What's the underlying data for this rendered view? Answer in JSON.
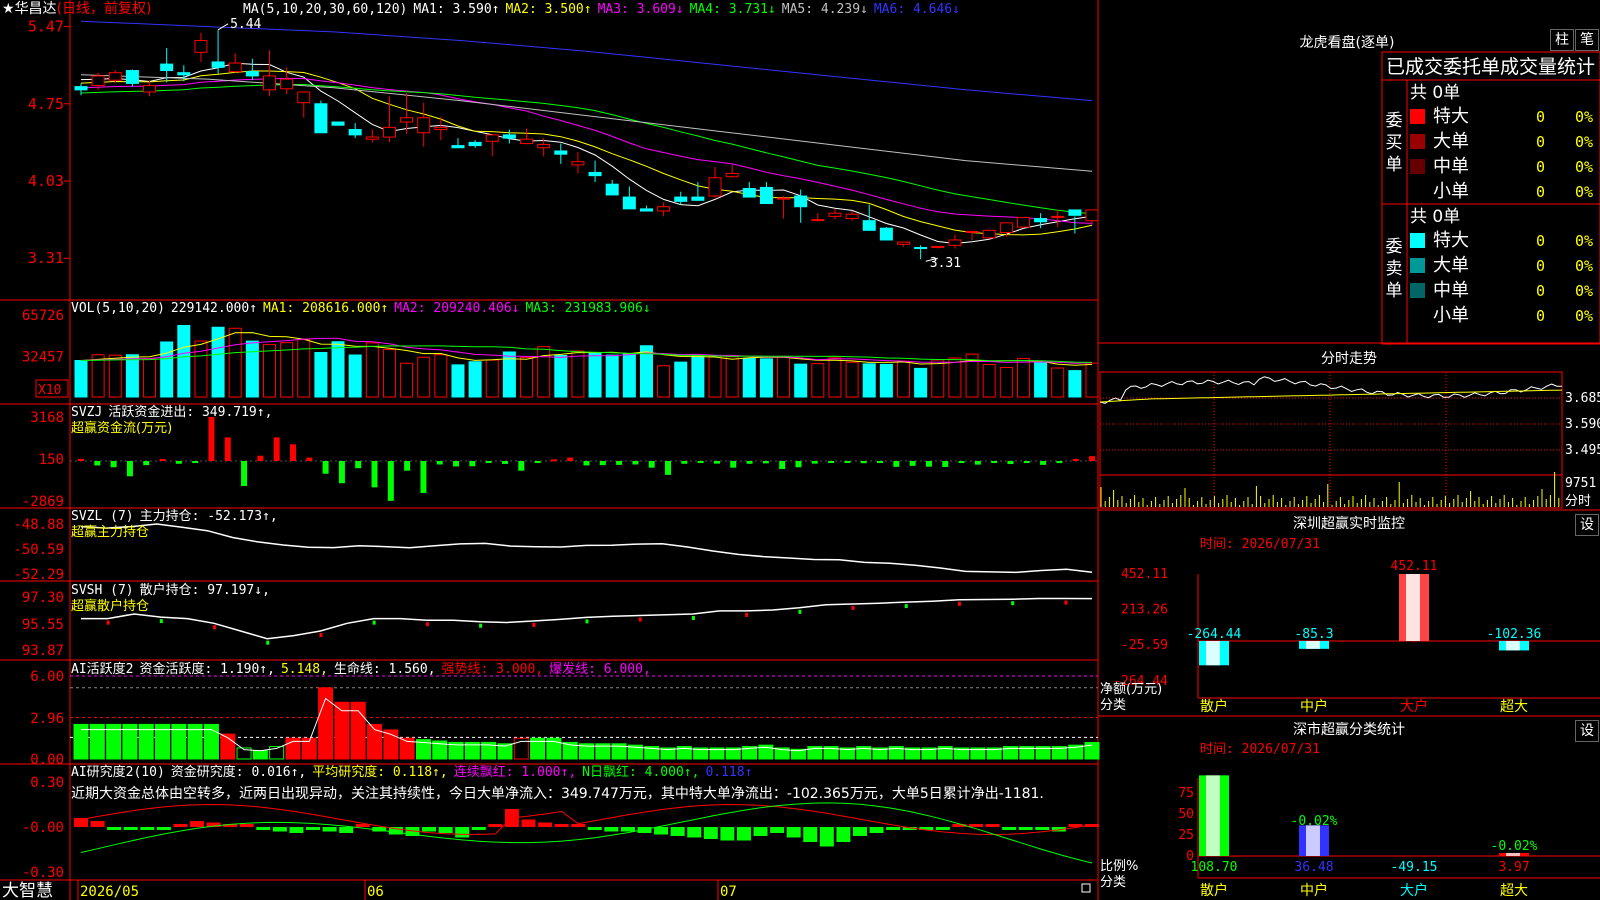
{
  "stock": {
    "star": "★",
    "name": "华昌达",
    "mode": "(日线，前复权)"
  },
  "kline": {
    "ma_header": [
      {
        "text": "MA(5,10,20,30,60,120)",
        "color": "#ffffff"
      },
      {
        "text": "MA1: 3.590↑",
        "color": "#ffffff"
      },
      {
        "text": "MA2: 3.500↑",
        "color": "#ffff00"
      },
      {
        "text": "MA3: 3.609↓",
        "color": "#ff00ff"
      },
      {
        "text": "MA4: 3.731↓",
        "color": "#00ff00"
      },
      {
        "text": "MA5: 4.239↓",
        "color": "#c0c0c0"
      },
      {
        "text": "MA6: 4.646↓",
        "color": "#3333ff"
      }
    ],
    "high_marker": "5.44",
    "low_marker": "3.31",
    "y_labels": [
      "5.47",
      "4.75",
      "4.03",
      "3.31"
    ]
  },
  "volume": {
    "header": [
      {
        "text": "VOL(5,10,20)",
        "color": "#ffffff"
      },
      {
        "text": "229142.000↑",
        "color": "#ffffff"
      },
      {
        "text": "MA1: 208616.000↑",
        "color": "#ffff00"
      },
      {
        "text": "MA2: 209240.406↓",
        "color": "#ff00ff"
      },
      {
        "text": "MA3: 231983.906↓",
        "color": "#00ff00"
      }
    ],
    "y_labels": [
      "65726",
      "32457"
    ],
    "unit": "X10"
  },
  "svzj": {
    "header": [
      {
        "text": "SVZJ",
        "color": "#ffffff"
      },
      {
        "text": "活跃资金进出: 349.719↑,",
        "color": "#ffffff"
      }
    ],
    "subtitle": "超赢资金流(万元)",
    "y_labels": [
      "3168",
      "150",
      "-2869"
    ]
  },
  "svzl": {
    "header": [
      {
        "text": "SVZL (7)",
        "color": "#ffffff"
      },
      {
        "text": "主力持仓: -52.173↑,",
        "color": "#ffffff"
      }
    ],
    "subtitle": "超赢主力持仓",
    "y_labels": [
      "-48.88",
      "-50.59",
      "-52.29"
    ]
  },
  "svsh": {
    "header": [
      {
        "text": "SVSH (7)",
        "color": "#ffffff"
      },
      {
        "text": "散户持仓: 97.197↓,",
        "color": "#ffffff"
      }
    ],
    "subtitle": "超赢散户持仓",
    "y_labels": [
      "97.30",
      "95.55",
      "93.87"
    ]
  },
  "ai_active": {
    "header": [
      {
        "text": "AI活跃度2",
        "color": "#ffffff"
      },
      {
        "text": "资金活跃度: 1.190↑,",
        "color": "#ffffff"
      },
      {
        "text": "5.148,",
        "color": "#ffff00"
      },
      {
        "text": "生命线: 1.560,",
        "color": "#ffffff"
      },
      {
        "text": "强势线: 3.000,",
        "color": "#ff0000"
      },
      {
        "text": "爆发线: 6.000,",
        "color": "#ff00ff"
      }
    ],
    "y_labels": [
      "6.00",
      "2.96",
      "0.00"
    ]
  },
  "ai_research": {
    "header": [
      {
        "text": "AI研究度2(10)",
        "color": "#ffffff"
      },
      {
        "text": "资金研究度: 0.016↑,",
        "color": "#ffffff"
      },
      {
        "text": "平均研究度: 0.118↑,",
        "color": "#ffff00"
      },
      {
        "text": "连续飘红: 1.000↑,",
        "color": "#ff00ff"
      },
      {
        "text": "N日飘红: 4.000↑,",
        "color": "#00ff00"
      },
      {
        "text": "0.118↑",
        "color": "#3333ff"
      }
    ],
    "commentary": "近期大资金总体由空转多，近两日出现异动，关注其持续性，今日大单净流入：349.747万元，其中特大单净流出：-102.365万元，大单5日累计净出-1181.",
    "y_labels": [
      "0.30",
      "-0.00",
      "-0.30"
    ]
  },
  "xaxis": {
    "brand": "大智慧",
    "labels": [
      "2026/05",
      "06",
      "07"
    ]
  },
  "lhb": {
    "title": "龙虎看盘(逐单)",
    "tab_zhu": "柱",
    "tab_bi": "笔",
    "stats_title": "已成交委托单成交量统计",
    "buy_label": "委买单",
    "sell_label": "委卖单",
    "buy": {
      "count": "共 0单",
      "rows": [
        {
          "label": "特大",
          "value": "0",
          "pct": "0%",
          "color": "#ff0000"
        },
        {
          "label": "大单",
          "value": "0",
          "pct": "0%",
          "color": "#990000"
        },
        {
          "label": "中单",
          "value": "0",
          "pct": "0%",
          "color": "#660000"
        },
        {
          "label": "小单",
          "value": "0",
          "pct": "0%",
          "color": "#000000"
        }
      ]
    },
    "sell": {
      "count": "共 0单",
      "rows": [
        {
          "label": "特大",
          "value": "0",
          "pct": "0%",
          "color": "#00ffff"
        },
        {
          "label": "大单",
          "value": "0",
          "pct": "0%",
          "color": "#009999"
        },
        {
          "label": "中单",
          "value": "0",
          "pct": "0%",
          "color": "#006666"
        },
        {
          "label": "小单",
          "value": "0",
          "pct": "0%",
          "color": "#000000"
        }
      ]
    }
  },
  "intraday": {
    "title": "分时走势",
    "y_labels": [
      "3.685",
      "3.590",
      "3.495"
    ],
    "vol_label": "9751",
    "vol_unit": "分时"
  },
  "monitor": {
    "title": "深圳超赢实时监控",
    "settings": "设",
    "time": "时间: 2026/07/31",
    "y_labels": [
      "452.11",
      "213.26",
      "-25.59",
      "-264.44"
    ],
    "axis_label_1": "净额(万元)",
    "axis_label_2": "分类",
    "categories": [
      "散户",
      "中户",
      "大户",
      "超大"
    ],
    "value_labels": [
      "-264.44",
      "-85.3",
      "452.11",
      "-102.36"
    ]
  },
  "classify": {
    "title": "深市超赢分类统计",
    "settings": "设",
    "time": "时间: 2026/07/31",
    "y_labels": [
      "75",
      "50",
      "25",
      "0"
    ],
    "axis_label_1": "比例%",
    "axis_label_2": "分类",
    "categories": [
      "散户",
      "中户",
      "大户",
      "超大"
    ],
    "bottom_values": [
      "108.70",
      "36.48",
      "-49.15",
      "3.97"
    ],
    "top_values": [
      "-0.02%",
      "-0.02%"
    ]
  },
  "chart_data": [
    {
      "type": "candlestick",
      "title": "华昌达(日线，前复权)",
      "ylim": [
        3.31,
        5.47
      ],
      "ohlc_approx": [
        [
          4.91,
          4.94,
          4.83,
          4.88
        ],
        [
          4.92,
          5.04,
          4.88,
          5.01
        ],
        [
          4.97,
          5.06,
          4.95,
          5.04
        ],
        [
          5.06,
          5.07,
          4.91,
          4.94
        ],
        [
          4.86,
          4.97,
          4.82,
          4.92
        ],
        [
          5.12,
          5.27,
          4.95,
          5.06
        ],
        [
          5.04,
          5.11,
          4.96,
          5.02
        ],
        [
          5.23,
          5.41,
          5.14,
          5.34
        ],
        [
          5.14,
          5.44,
          5.03,
          5.09
        ],
        [
          5.05,
          5.22,
          5.04,
          5.13
        ],
        [
          5.05,
          5.17,
          4.97,
          5.01
        ],
        [
          4.88,
          5.25,
          4.82,
          5.01
        ],
        [
          4.89,
          5.09,
          4.84,
          4.98
        ],
        [
          4.76,
          4.85,
          4.62,
          4.86
        ],
        [
          4.75,
          4.78,
          4.55,
          4.48
        ],
        [
          4.58,
          4.57,
          4.55,
          4.55
        ],
        [
          4.51,
          4.57,
          4.43,
          4.46
        ],
        [
          4.42,
          4.51,
          4.39,
          4.44
        ],
        [
          4.44,
          4.82,
          4.39,
          4.53
        ],
        [
          4.58,
          4.85,
          4.47,
          4.62
        ],
        [
          4.48,
          4.76,
          4.35,
          4.62
        ],
        [
          4.51,
          4.63,
          4.41,
          4.53
        ],
        [
          4.36,
          4.43,
          4.34,
          4.34
        ],
        [
          4.39,
          4.41,
          4.34,
          4.36
        ],
        [
          4.4,
          4.42,
          4.26,
          4.46
        ],
        [
          4.46,
          4.51,
          4.38,
          4.43
        ],
        [
          4.38,
          4.52,
          4.37,
          4.42
        ],
        [
          4.34,
          4.43,
          4.26,
          4.37
        ],
        [
          4.31,
          4.38,
          4.19,
          4.28
        ],
        [
          4.18,
          4.3,
          4.1,
          4.21
        ],
        [
          4.11,
          4.22,
          4.02,
          4.08
        ],
        [
          4.0,
          4.04,
          3.95,
          3.9
        ],
        [
          3.88,
          3.98,
          3.84,
          3.77
        ],
        [
          3.77,
          3.8,
          3.77,
          3.75
        ],
        [
          3.75,
          3.83,
          3.7,
          3.79
        ],
        [
          3.88,
          3.93,
          3.81,
          3.84
        ],
        [
          3.88,
          4.02,
          3.85,
          3.85
        ],
        [
          3.89,
          4.16,
          3.87,
          4.06
        ],
        [
          4.07,
          4.18,
          4.06,
          4.1
        ],
        [
          3.96,
          4.02,
          3.93,
          3.88
        ],
        [
          3.97,
          4.02,
          3.9,
          3.82
        ],
        [
          3.87,
          3.89,
          3.68,
          3.87
        ],
        [
          3.89,
          3.95,
          3.64,
          3.79
        ],
        [
          3.67,
          3.73,
          3.67,
          3.67
        ],
        [
          3.7,
          3.77,
          3.67,
          3.73
        ],
        [
          3.68,
          3.75,
          3.66,
          3.72
        ],
        [
          3.66,
          3.81,
          3.64,
          3.57
        ],
        [
          3.59,
          3.6,
          3.58,
          3.48
        ],
        [
          3.44,
          3.46,
          3.42,
          3.46
        ],
        [
          3.41,
          3.43,
          3.3,
          3.4
        ],
        [
          3.41,
          3.42,
          3.4,
          3.42
        ],
        [
          3.43,
          3.53,
          3.4,
          3.48
        ],
        [
          3.56,
          3.55,
          3.48,
          3.56
        ],
        [
          3.5,
          3.56,
          3.49,
          3.57
        ],
        [
          3.55,
          3.61,
          3.51,
          3.64
        ],
        [
          3.6,
          3.64,
          3.59,
          3.69
        ],
        [
          3.68,
          3.73,
          3.59,
          3.65
        ],
        [
          3.7,
          3.76,
          3.6,
          3.7
        ],
        [
          3.76,
          3.7,
          3.54,
          3.71
        ],
        [
          3.66,
          3.75,
          3.62,
          3.76
        ]
      ]
    },
    {
      "type": "bar",
      "title": "VOL(5,10,20)",
      "values_approx_x10": [
        29200,
        33800,
        33500,
        33800,
        30600,
        44000,
        57200,
        44800,
        55800,
        55000,
        44700,
        41900,
        43500,
        45900,
        35600,
        44200,
        33600,
        43300,
        38000,
        27000,
        31800,
        33800,
        25700,
        28200,
        29500,
        36000,
        31600,
        40300,
        33200,
        36800,
        35500,
        33500,
        34500,
        41000,
        25000,
        27900,
        33300,
        32800,
        32200,
        31000,
        30500,
        32500,
        26300,
        26700,
        31300,
        27800,
        26500,
        26100,
        28600,
        22900,
        29600,
        31200,
        34300,
        26000,
        23600,
        30800,
        28000,
        23200,
        21100,
        27100
      ]
    },
    {
      "type": "bar",
      "title": "活跃资金进出",
      "values_approx": [
        150,
        -320,
        -450,
        -1100,
        -300,
        150,
        -200,
        -120,
        3168,
        1700,
        -1800,
        380,
        1700,
        1200,
        250,
        -920,
        -1600,
        -520,
        -1900,
        -2869,
        -700,
        -2300,
        -250,
        -390,
        -380,
        -100,
        -210,
        -700,
        -100,
        120,
        250,
        -320,
        -300,
        -280,
        -250,
        -480,
        -1000,
        -200,
        -120,
        -190,
        -480,
        -200,
        -170,
        -580,
        -450,
        -190,
        -100,
        -110,
        -160,
        -90,
        -420,
        -350,
        -410,
        -430,
        -120,
        -260,
        -120,
        -220,
        -140,
        -280,
        -150,
        150,
        349
      ]
    },
    {
      "type": "line",
      "title": "主力持仓",
      "ylim": [
        -52.29,
        -48.88
      ],
      "values_approx": [
        -49.06,
        -49.16,
        -49.06,
        -48.88,
        -49.1,
        -49.34,
        -49.8,
        -50.1,
        -50.31,
        -50.46,
        -50.49,
        -50.36,
        -50.42,
        -50.5,
        -50.36,
        -50.24,
        -50.2,
        -50.39,
        -50.43,
        -50.45,
        -50.34,
        -50.33,
        -50.25,
        -50.23,
        -50.45,
        -50.72,
        -50.95,
        -51.1,
        -51.2,
        -51.3,
        -51.32,
        -51.5,
        -51.56,
        -51.7,
        -51.88,
        -52.11,
        -52.15,
        -52.18,
        -52.05,
        -51.97,
        -52.17
      ]
    },
    {
      "type": "line",
      "title": "散户持仓",
      "ylim": [
        93.87,
        97.3
      ],
      "values_approx": [
        95.9,
        95.9,
        96.2,
        96.0,
        95.9,
        95.6,
        95.1,
        94.6,
        94.8,
        95.1,
        95.6,
        95.9,
        95.9,
        95.8,
        95.8,
        95.7,
        95.65,
        95.75,
        95.85,
        95.98,
        96.05,
        96.1,
        96.15,
        96.2,
        96.4,
        96.4,
        96.46,
        96.6,
        96.8,
        96.85,
        96.9,
        96.97,
        97.03,
        97.12,
        97.14,
        97.16,
        97.2,
        97.2,
        97.197
      ]
    },
    {
      "type": "bar",
      "title": "资金活跃度",
      "ylim": [
        0,
        6.0
      ],
      "values_approx": [
        2.5,
        2.5,
        2.5,
        2.5,
        2.5,
        2.5,
        2.5,
        2.5,
        2.5,
        1.8,
        0.8,
        0.6,
        0.9,
        1.5,
        1.5,
        5.148,
        4.1,
        4.1,
        2.5,
        2.1,
        1.5,
        1.4,
        1.3,
        1.2,
        1.2,
        1.2,
        1.1,
        1.5,
        1.5,
        1.5,
        1.2,
        1.1,
        1.1,
        1.1,
        1.0,
        0.9,
        0.8,
        0.9,
        0.8,
        0.8,
        0.8,
        0.9,
        1.0,
        0.8,
        0.7,
        0.9,
        0.9,
        0.8,
        0.9,
        0.8,
        0.9,
        0.8,
        0.8,
        0.9,
        0.8,
        0.8,
        0.8,
        0.9,
        0.9,
        0.9,
        0.9,
        1.0,
        1.19
      ]
    },
    {
      "type": "bar",
      "title": "资金研究度",
      "ylim": [
        -0.3,
        0.3
      ],
      "values_approx": [
        0.06,
        0.04,
        -0.01,
        -0.01,
        -0.02,
        -0.02,
        0.0,
        0.04,
        0.03,
        0.01,
        0.0,
        -0.02,
        -0.03,
        -0.04,
        -0.02,
        -0.03,
        -0.04,
        0.0,
        -0.03,
        -0.05,
        -0.06,
        -0.03,
        -0.04,
        -0.07,
        -0.02,
        0.01,
        0.12,
        0.05,
        0.03,
        0.01,
        0.0,
        -0.01,
        -0.03,
        -0.03,
        -0.04,
        -0.05,
        -0.06,
        -0.07,
        -0.08,
        -0.09,
        -0.09,
        -0.06,
        -0.04,
        -0.07,
        -0.1,
        -0.13,
        -0.1,
        -0.06,
        -0.04,
        -0.02,
        -0.01,
        -0.01,
        -0.02,
        0.0,
        0.0,
        0.01,
        -0.02,
        -0.02,
        -0.02,
        -0.03,
        0.0,
        0.016
      ]
    },
    {
      "type": "bar",
      "title": "深圳超赢实时监控",
      "categories": [
        "散户",
        "中户",
        "大户",
        "超大"
      ],
      "values": [
        -264.44,
        -85.3,
        452.11,
        -102.36
      ],
      "ylabel": "净额(万元)",
      "ylim": [
        -264.44,
        452.11
      ]
    },
    {
      "type": "bar",
      "title": "深市超赢分类统计",
      "categories": [
        "散户",
        "中户",
        "大户",
        "超大"
      ],
      "values": [
        108.7,
        36.48,
        -49.15,
        3.97
      ],
      "ylabel": "比例%",
      "ylim": [
        0,
        100
      ]
    }
  ]
}
